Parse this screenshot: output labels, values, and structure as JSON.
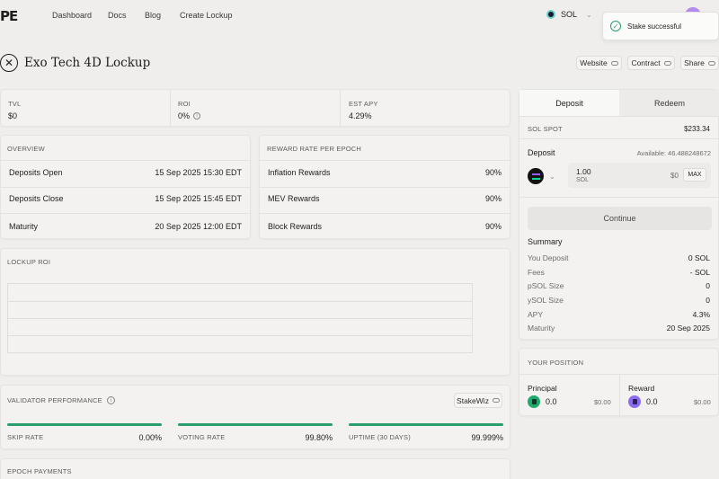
{
  "nav": {
    "logo": "PE",
    "items": [
      "Dashboard",
      "Docs",
      "Blog",
      "Create Lockup"
    ],
    "network": "SOL"
  },
  "toast": {
    "message": "Stake successful"
  },
  "page": {
    "title": "Exo Tech 4D Lockup",
    "links": [
      "Website",
      "Contract",
      "Share"
    ]
  },
  "stats": [
    {
      "label": "TVL",
      "value": "$0"
    },
    {
      "label": "ROI",
      "value": "0%"
    },
    {
      "label": "EST APY",
      "value": "4.29%"
    }
  ],
  "overview": {
    "title": "OVERVIEW",
    "rows": [
      {
        "label": "Deposits Open",
        "value": "15 Sep 2025 15:30 EDT"
      },
      {
        "label": "Deposits Close",
        "value": "15 Sep 2025 15:45 EDT"
      },
      {
        "label": "Maturity",
        "value": "20 Sep 2025 12:00 EDT"
      }
    ]
  },
  "reward_rate": {
    "title": "REWARD RATE PER EPOCH",
    "rows": [
      {
        "label": "Inflation Rewards",
        "value": "90%"
      },
      {
        "label": "MEV Rewards",
        "value": "90%"
      },
      {
        "label": "Block Rewards",
        "value": "90%"
      }
    ]
  },
  "lockup_roi": {
    "title": "LOCKUP ROI"
  },
  "validator": {
    "title": "VALIDATOR PERFORMANCE",
    "source": "StakeWiz",
    "metrics": [
      {
        "label": "SKIP RATE",
        "value": "0.00%",
        "fill": 1.0
      },
      {
        "label": "VOTING RATE",
        "value": "99.80%",
        "fill": 0.998
      },
      {
        "label": "UPTIME (30 DAYS)",
        "value": "99.999%",
        "fill": 0.99999
      }
    ]
  },
  "epoch_payments": {
    "title": "EPOCH PAYMENTS"
  },
  "panel": {
    "tabs": [
      "Deposit",
      "Redeem"
    ],
    "spot_label": "SOL SPOT",
    "spot_value": "$233.34",
    "deposit_label": "Deposit",
    "available": "Available: 46.488248672",
    "amount": "1.00",
    "token": "SOL",
    "usd": "$0",
    "max": "MAX",
    "continue": "Continue",
    "summary_title": "Summary",
    "summary": [
      {
        "label": "You Deposit",
        "value": "0 SOL"
      },
      {
        "label": "Fees",
        "value": "- SOL"
      },
      {
        "label": "pSOL Size",
        "value": "0"
      },
      {
        "label": "ySOL Size",
        "value": "0"
      },
      {
        "label": "APY",
        "value": "4.3%"
      },
      {
        "label": "Maturity",
        "value": "20 Sep 2025"
      }
    ]
  },
  "position": {
    "title": "YOUR POSITION",
    "principal": {
      "label": "Principal",
      "value": "0.0",
      "usd": "$0.00"
    },
    "reward": {
      "label": "Reward",
      "value": "0.0",
      "usd": "$0.00"
    }
  },
  "colors": {
    "accent_green": "#2a9d6c",
    "psol_green": "#1faa6d",
    "ysol_purple": "#8b6cf0",
    "avatar": "#b58cf2"
  }
}
